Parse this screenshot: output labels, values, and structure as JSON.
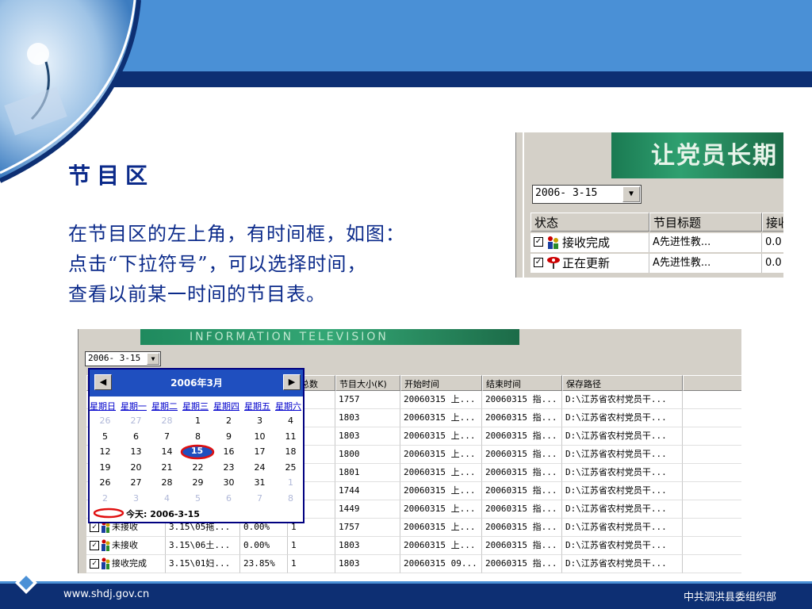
{
  "slide": {
    "title": "节目区",
    "body_lines": [
      "在节目区的左上角，有时间框，如图：",
      "点击“下拉符号”，可以选择时间，",
      "查看以前某一时间的节目表。"
    ],
    "footer_url": "www.shdj.gov.cn",
    "footer_org": "中共泗洪县委组织部"
  },
  "colors": {
    "title_text": "#0b2a8a",
    "header_blue": "#4a90d6",
    "header_dark": "#0d2f73",
    "calendar_header": "#1f4fbf"
  },
  "screenshot_small": {
    "banner_text": "让党员长期",
    "date_value": "2006- 3-15",
    "dropdown_icon": "chevron-down-icon",
    "columns": [
      "状态",
      "节目标题",
      "接收"
    ],
    "rows": [
      {
        "status": "接收完成",
        "title": "A先进性教...",
        "progress": "0.0"
      },
      {
        "status": "正在更新",
        "title": "A先进性教...",
        "progress": "0.0"
      }
    ]
  },
  "screenshot_big": {
    "banner_text": "INFORMATION TELEVISION",
    "date_value": "2006- 3-15",
    "columns": [
      "",
      "",
      "",
      "件总数",
      "节目大小(K)",
      "开始时间",
      "结束时间",
      "保存路径"
    ],
    "rows": [
      {
        "status": "",
        "title": "",
        "progress": "",
        "count": "",
        "size": "1757",
        "start": "20060315 上...",
        "end": "20060315 指...",
        "path": "D:\\江苏省农村党员干..."
      },
      {
        "status": "",
        "title": "",
        "progress": "",
        "count": "",
        "size": "1803",
        "start": "20060315 上...",
        "end": "20060315 指...",
        "path": "D:\\江苏省农村党员干..."
      },
      {
        "status": "",
        "title": "",
        "progress": "",
        "count": "",
        "size": "1803",
        "start": "20060315 上...",
        "end": "20060315 指...",
        "path": "D:\\江苏省农村党员干..."
      },
      {
        "status": "",
        "title": "",
        "progress": "",
        "count": "",
        "size": "1800",
        "start": "20060315 上...",
        "end": "20060315 指...",
        "path": "D:\\江苏省农村党员干..."
      },
      {
        "status": "",
        "title": "",
        "progress": "",
        "count": "",
        "size": "1801",
        "start": "20060315 上...",
        "end": "20060315 指...",
        "path": "D:\\江苏省农村党员干..."
      },
      {
        "status": "",
        "title": "",
        "progress": "",
        "count": "",
        "size": "1744",
        "start": "20060315 上...",
        "end": "20060315 指...",
        "path": "D:\\江苏省农村党员干..."
      },
      {
        "status": "",
        "title": "",
        "progress": "",
        "count": "",
        "size": "1449",
        "start": "20060315 上...",
        "end": "20060315 指...",
        "path": "D:\\江苏省农村党员干..."
      },
      {
        "status": "未接收",
        "title": "3.15\\05拖...",
        "progress": "0.00%",
        "count": "1",
        "size": "1757",
        "start": "20060315 上...",
        "end": "20060315 指...",
        "path": "D:\\江苏省农村党员干..."
      },
      {
        "status": "未接收",
        "title": "3.15\\06土...",
        "progress": "0.00%",
        "count": "1",
        "size": "1803",
        "start": "20060315 上...",
        "end": "20060315 指...",
        "path": "D:\\江苏省农村党员干..."
      },
      {
        "status": "接收完成",
        "title": "3.15\\01妇...",
        "progress": "23.85%",
        "count": "1",
        "size": "1803",
        "start": "20060315 09...",
        "end": "20060315 指...",
        "path": "D:\\江苏省农村党员干..."
      }
    ],
    "calendar": {
      "month_label": "2006年3月",
      "prev_icon": "triangle-left-icon",
      "next_icon": "triangle-right-icon",
      "weekdays": [
        "星期日",
        "星期一",
        "星期二",
        "星期三",
        "星期四",
        "星期五",
        "星期六"
      ],
      "weeks": [
        [
          "26",
          "27",
          "28",
          "1",
          "2",
          "3",
          "4"
        ],
        [
          "5",
          "6",
          "7",
          "8",
          "9",
          "10",
          "11"
        ],
        [
          "12",
          "13",
          "14",
          "15",
          "16",
          "17",
          "18"
        ],
        [
          "19",
          "20",
          "21",
          "22",
          "23",
          "24",
          "25"
        ],
        [
          "26",
          "27",
          "28",
          "29",
          "30",
          "31",
          "1"
        ],
        [
          "2",
          "3",
          "4",
          "5",
          "6",
          "7",
          "8"
        ]
      ],
      "selected_day": "15",
      "today_label": "今天: 2006-3-15"
    }
  }
}
